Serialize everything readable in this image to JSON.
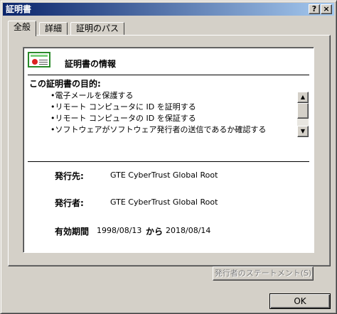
{
  "window": {
    "title": "証明書",
    "help_glyph": "?",
    "close_glyph": "×"
  },
  "tabs": [
    {
      "label": "全般",
      "active": true
    },
    {
      "label": "詳細",
      "active": false
    },
    {
      "label": "証明のパス",
      "active": false
    }
  ],
  "info": {
    "title": "証明書の情報",
    "icon": "certificate-icon",
    "purpose_title": "この証明書の目的:",
    "purposes": [
      "電子メールを保護する",
      "リモート コンピュータに ID を証明する",
      "リモート コンピュータの ID を保証する",
      "ソフトウェアがソフトウェア発行者の送信であるか確認する"
    ],
    "issued_to_label": "発行先:",
    "issued_to": "GTE CyberTrust Global Root",
    "issued_by_label": "発行者:",
    "issued_by": "GTE CyberTrust Global Root",
    "validity_label": "有効期間",
    "valid_from": "1998/08/13",
    "valid_to_connector": "から",
    "valid_to": "2018/08/14"
  },
  "buttons": {
    "issuer_statement": "発行者のステートメント(S)",
    "ok": "OK"
  },
  "scrollbar": {
    "up_glyph": "▲",
    "down_glyph": "▼"
  },
  "colors": {
    "titlebar_start": "#0a246a",
    "titlebar_end": "#a6caf0",
    "face": "#d4d0c8"
  }
}
